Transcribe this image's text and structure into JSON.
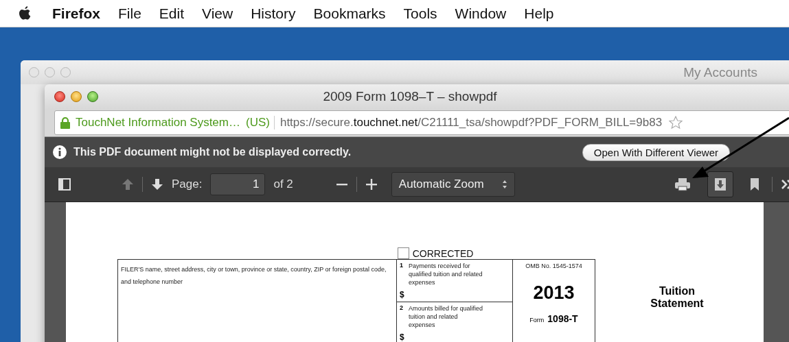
{
  "menubar": {
    "app": "Firefox",
    "items": [
      "File",
      "Edit",
      "View",
      "History",
      "Bookmarks",
      "Tools",
      "Window",
      "Help"
    ]
  },
  "back_window": {
    "title": "My Accounts"
  },
  "window": {
    "title": "2009 Form 1098–T – showpdf",
    "identity": "TouchNet Information System…",
    "country": "(US)",
    "url": {
      "scheme": "https://secure.",
      "domain": "touchnet.net",
      "path": "/C21111_tsa/showpdf?PDF_FORM_BILL=9b83"
    }
  },
  "notification": {
    "message": "This PDF document might not be displayed correctly.",
    "button": "Open With Different Viewer"
  },
  "toolbar": {
    "page_label": "Page:",
    "page_value": "1",
    "page_count": "of 2",
    "zoom": "Automatic Zoom"
  },
  "document": {
    "corrected": {
      "label": "CORRECTED",
      "checked": false
    },
    "filer_label": "FILER'S name, street address, city or town, province or state, country, ZIP or foreign postal code, and telephone number",
    "boxes": [
      {
        "number": "1",
        "label": "Payments received for qualified tuition and related expenses",
        "currency": "$"
      },
      {
        "number": "2",
        "label": "Amounts billed for qualified tuition and related expenses",
        "currency": "$"
      }
    ],
    "omb": "OMB No. 1545-1574",
    "year": "2013",
    "form_word": "Form",
    "form_number": "1098-T",
    "title": "Tuition Statement"
  }
}
